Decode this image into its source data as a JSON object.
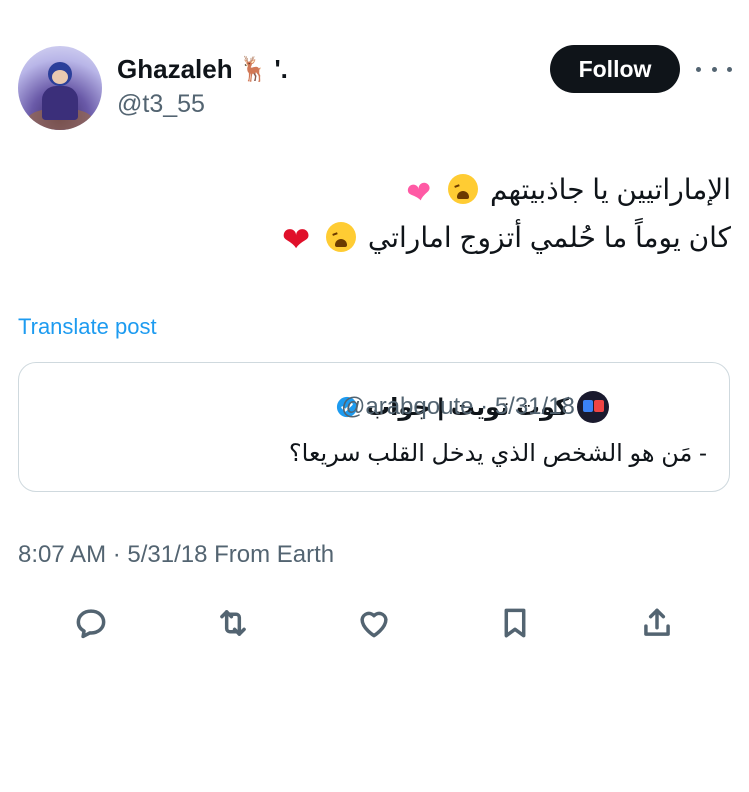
{
  "author": {
    "display_name": "Ghazaleh",
    "name_emoji": "🦌",
    "name_suffix": "'.",
    "handle": "@t3_55"
  },
  "follow_label": "Follow",
  "tweet": {
    "line1": "الإماراتيين يا جاذبيتهم",
    "line2": "كان يوماً ما حُلمي أتزوج اماراتي",
    "emojis": [
      "weary-face",
      "heart-with-arrow",
      "weary-face",
      "red-heart"
    ]
  },
  "translate_label": "Translate post",
  "quoted": {
    "name": "كوت تويت | جواب",
    "handle": "@arabqoute",
    "separator": "·",
    "date": "5/31/18",
    "text": "- مَن هو الشخص الذي يدخل القلب سريعا؟",
    "verified_color": "#1d9bf0"
  },
  "timestamp": "8:07 AM · 5/31/18 From Earth",
  "actions": [
    "reply-icon",
    "retweet-icon",
    "like-icon",
    "bookmark-icon",
    "share-icon"
  ],
  "colors": {
    "text": "#0f1419",
    "secondary": "#536471",
    "link": "#1d9bf0",
    "button": "#0f1419",
    "border": "#cfd9de"
  }
}
